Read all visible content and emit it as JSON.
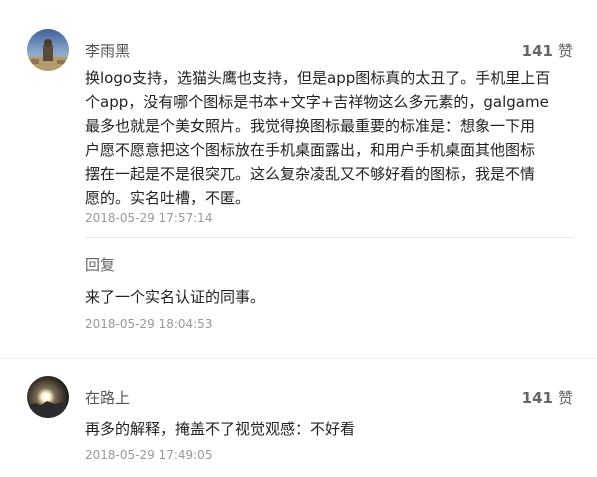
{
  "comments": [
    {
      "username": "李雨黑",
      "likes": "141",
      "like_label": "赞",
      "lines": [
        "换logo支持，选猫头鹰也支持，但是app图标真的太丑了。手机里上百",
        "个app，没有哪个图标是书本+文字+吉祥物这么多元素的，galgame",
        "最多也就是个美女照片。我觉得换图标最重要的标准是：想象一下用",
        "户愿不愿意把这个图标放在手机桌面露出，和用户手机桌面其他图标",
        "摆在一起是不是很突兀。这么复杂凌乱又不够好看的图标，我是不情",
        "愿的。实名吐槽，不匿。"
      ],
      "time": "2018-05-29 17:57:14",
      "reply": {
        "label": "回复",
        "text": "来了一个实名认证的同事。",
        "time": "2018-05-29 18:04:53"
      }
    },
    {
      "username": "在路上",
      "likes": "141",
      "like_label": "赞",
      "text": "再多的解释，掩盖不了视觉观感：不好看",
      "time": "2018-05-29 17:49:05"
    }
  ]
}
